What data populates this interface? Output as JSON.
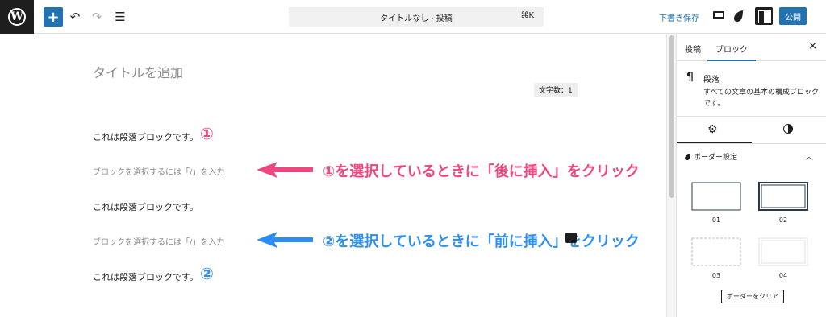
{
  "toolbar": {
    "add_label": "+",
    "undo_label": "↶",
    "redo_label": "↷",
    "list_view_label": "☰",
    "command_bar_title": "タイトルなし · 投稿",
    "command_bar_shortcut": "⌘K",
    "save_draft_label": "下書き保存",
    "publish_label": "公開",
    "logo_text": "W"
  },
  "editor": {
    "title_placeholder": "タイトルを追加",
    "char_count": "文字数：1",
    "paragraph_1": "これは段落ブロックです。",
    "badge_1": "①",
    "placeholder_1": "ブロックを選択するには「/」を入力",
    "paragraph_2": "これは段落ブロックです。",
    "placeholder_2": "ブロックを選択するには「/」を入力",
    "paragraph_3": "これは段落ブロックです。",
    "badge_2": "②"
  },
  "annotations": {
    "arrow_1_text": "①を選択しているときに「後に挿入」をクリック",
    "arrow_1_color": "#f0457e",
    "arrow_2_text": "②を選択しているときに「前に挿入」をクリック",
    "arrow_2_color": "#2c8ef2"
  },
  "sidebar": {
    "tab_post": "投稿",
    "tab_block": "ブロック",
    "close_label": "×",
    "block_icon": "¶",
    "block_title": "段落",
    "block_description": "すべての文章の基本の構成ブロックです。",
    "settings_tab_icon": "gear-icon",
    "styles_tab_icon": "contrast-icon",
    "panel_title": "ボーダー設定",
    "border_options": [
      "01",
      "02",
      "03",
      "04"
    ],
    "clear_button_label": "ボーダーをクリア"
  },
  "colors": {
    "accent": "#2271b1",
    "dark": "#1e1e1e"
  }
}
